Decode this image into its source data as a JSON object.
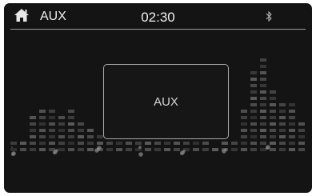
{
  "header": {
    "home_icon": "home-icon",
    "source": "AUX",
    "time": "02:30",
    "bluetooth_icon": "bluetooth-icon"
  },
  "main": {
    "source_label": "AUX"
  },
  "colors": {
    "background": "#141414",
    "text": "#f0f0f0",
    "divider": "#9a9a9a"
  }
}
